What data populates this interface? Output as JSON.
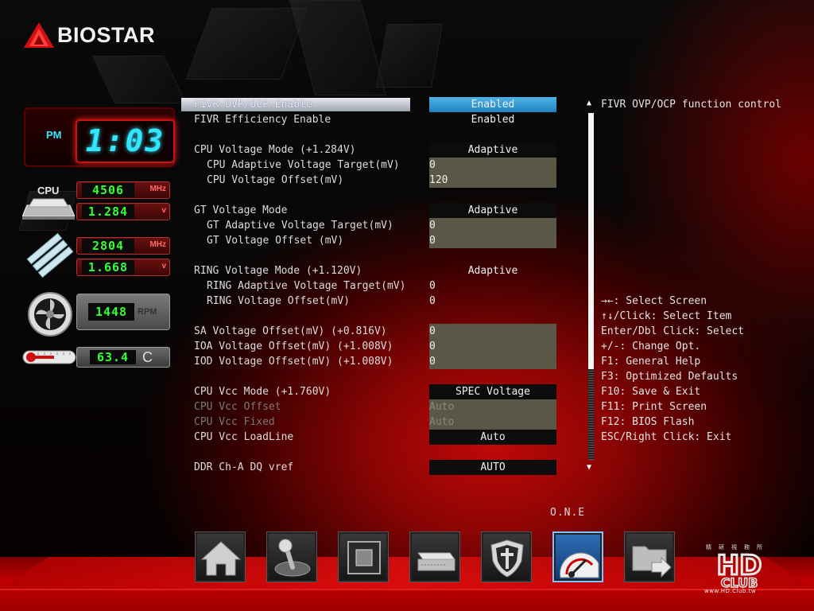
{
  "brand": {
    "name": "BIOSTAR"
  },
  "clock": {
    "ampm": "PM",
    "time": "1:03"
  },
  "monitor": {
    "cpu_label": "CPU",
    "cpu_freq": {
      "value": "4506",
      "unit": "MHz"
    },
    "cpu_volt": {
      "value": "1.284",
      "unit": "v"
    },
    "mem_freq": {
      "value": "2804",
      "unit": "MHz"
    },
    "mem_volt": {
      "value": "1.668",
      "unit": "v"
    },
    "fan": {
      "value": "1448",
      "unit": "RPM"
    },
    "temp": {
      "value": "63.4",
      "unit": "C"
    }
  },
  "settings": [
    {
      "label": "FIVR OVP/OCP Enable",
      "value": "Enabled",
      "style": "sel",
      "indent": false,
      "selected": true
    },
    {
      "label": "FIVR Efficiency Enable",
      "value": "Enabled",
      "style": "none",
      "indent": false
    },
    {
      "label": "CPU Voltage Mode (+1.284V)",
      "value": "Adaptive",
      "style": "dark",
      "indent": false
    },
    {
      "label": "CPU Adaptive Voltage Target(mV)",
      "value": "0",
      "style": "num",
      "indent": true
    },
    {
      "label": "CPU Voltage Offset(mV)",
      "value": "120",
      "style": "num",
      "indent": true
    },
    {
      "label": "GT Voltage Mode",
      "value": "Adaptive",
      "style": "dark",
      "indent": false
    },
    {
      "label": "GT Adaptive Voltage Target(mV)",
      "value": "0",
      "style": "num",
      "indent": true
    },
    {
      "label": "GT Voltage Offset (mV)",
      "value": "0",
      "style": "num",
      "indent": true
    },
    {
      "label": "RING Voltage Mode (+1.120V)",
      "value": "Adaptive",
      "style": "none",
      "indent": false
    },
    {
      "label": "RING Adaptive Voltage Target(mV)",
      "value": "0",
      "style": "none-left",
      "indent": true
    },
    {
      "label": "RING Voltage Offset(mV)",
      "value": "0",
      "style": "none-left",
      "indent": true
    },
    {
      "label": "SA Voltage Offset(mV) (+0.816V)",
      "value": "0",
      "style": "num",
      "indent": false
    },
    {
      "label": "IOA Voltage Offset(mV) (+1.008V)",
      "value": "0",
      "style": "num",
      "indent": false
    },
    {
      "label": "IOD Voltage Offset(mV) (+1.008V)",
      "value": "0",
      "style": "num",
      "indent": false
    },
    {
      "label": "CPU Vcc Mode (+1.760V)",
      "value": "SPEC Voltage",
      "style": "dark",
      "indent": false
    },
    {
      "label": "CPU Vcc Offset",
      "value": "Auto",
      "style": "num",
      "indent": false,
      "disabled": true
    },
    {
      "label": "CPU Vcc Fixed",
      "value": "Auto",
      "style": "num",
      "indent": false,
      "disabled": true
    },
    {
      "label": "CPU Vcc LoadLine",
      "value": "Auto",
      "style": "dark",
      "indent": false
    },
    {
      "label": "DDR Ch-A DQ vref",
      "value": "AUTO",
      "style": "dark",
      "indent": false
    }
  ],
  "help": {
    "description": "FIVR OVP/OCP function control",
    "keys": [
      "→←: Select Screen",
      "↑↓/Click: Select Item",
      "Enter/Dbl Click: Select",
      "+/-: Change Opt.",
      "F1: General Help",
      "F3: Optimized Defaults",
      "F10: Save & Exit",
      "F11: Print Screen",
      "F12: BIOS Flash",
      "ESC/Right Click: Exit"
    ]
  },
  "nav": {
    "active_label": "O.N.E",
    "buttons": [
      {
        "name": "main",
        "icon": "home-icon"
      },
      {
        "name": "advanced",
        "icon": "joystick-icon"
      },
      {
        "name": "chipset",
        "icon": "chip-icon"
      },
      {
        "name": "boot",
        "icon": "drive-icon"
      },
      {
        "name": "security",
        "icon": "shield-icon"
      },
      {
        "name": "one",
        "icon": "speedometer-icon"
      },
      {
        "name": "exit",
        "icon": "folder-exit-icon"
      }
    ]
  },
  "watermark": {
    "cn": "精研視務所",
    "hd": "HD",
    "club": "CLUB",
    "url": "www.HD.Club.tw"
  },
  "colors": {
    "accent": "#2f8fd0",
    "lcd_green": "#34ff34",
    "clock_cyan": "#33e6ff",
    "brand_red": "#c00000"
  }
}
